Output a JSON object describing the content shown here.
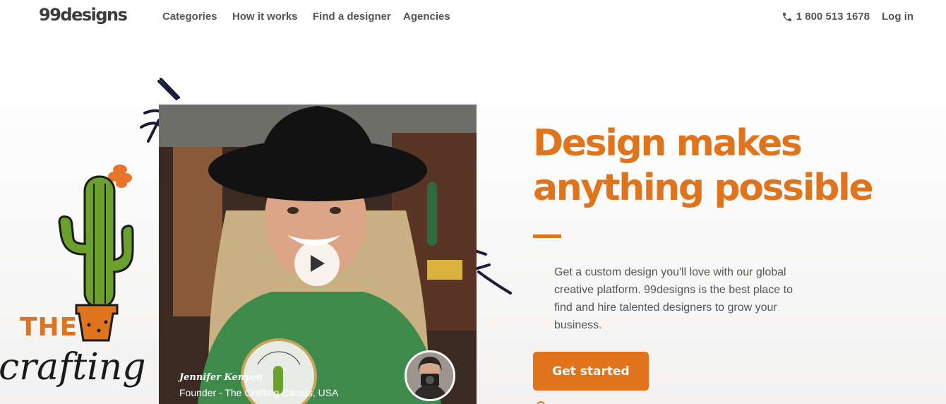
{
  "nav": {
    "logo": "99designs",
    "links": [
      "Categories",
      "How it works",
      "Find a designer",
      "Agencies"
    ],
    "phone": "1 800 513 1678",
    "login": "Log in"
  },
  "illustration": {
    "brand_top": "THE",
    "brand_script": "crafting cactus"
  },
  "video": {
    "name": "Jennifer Kenyon",
    "role": "Founder - The Crafting Cactus, USA",
    "badge_text": "the crafting cactus"
  },
  "hero": {
    "headline_line1": "Design makes",
    "headline_line2": "anything possible",
    "description": "Get a custom design you'll love with our global creative platform. 99designs is the best place to find and hire talented designers to grow your business.",
    "cta": "Get started"
  },
  "colors": {
    "accent": "#e0741c",
    "text": "#555555"
  }
}
